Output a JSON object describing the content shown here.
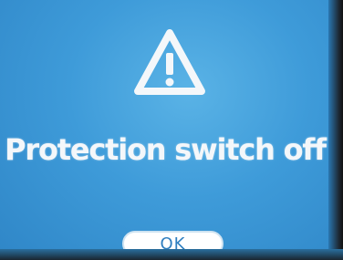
{
  "dialog": {
    "icon": "warning-triangle-icon",
    "message": "Protection switch off",
    "ok_label": "OK"
  },
  "colors": {
    "background": "#3e9bd9",
    "text": "#f4f7fa",
    "button_bg": "#ffffff",
    "button_text": "#2f7fc0"
  }
}
